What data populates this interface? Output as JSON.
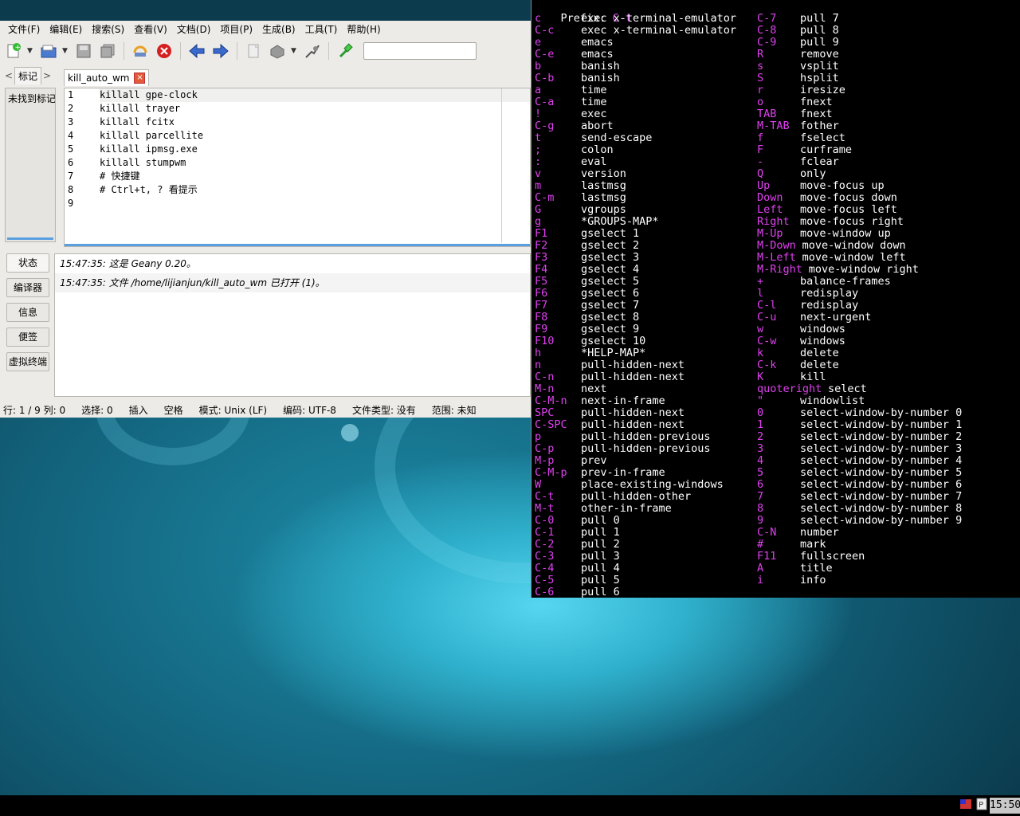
{
  "geany": {
    "menu": [
      "文件(F)",
      "编辑(E)",
      "搜索(S)",
      "查看(V)",
      "文档(D)",
      "项目(P)",
      "生成(B)",
      "工具(T)",
      "帮助(H)"
    ],
    "sidebar": {
      "tab_label": "标记",
      "empty_text": "未找到标记"
    },
    "editor_tab": {
      "label": "kill_auto_wm",
      "close": "×"
    },
    "lines": [
      "1",
      "2",
      "3",
      "4",
      "5",
      "6",
      "7",
      "8",
      "9"
    ],
    "code": [
      "killall gpe-clock",
      "killall trayer",
      "killall fcitx",
      "killall parcellite",
      "killall ipmsg.exe",
      "killall stumpwm",
      "# 快捷键",
      "# Ctrl+t, ? 看提示",
      ""
    ],
    "message_tabs": [
      "状态",
      "编译器",
      "信息",
      "便签",
      "虚拟终端"
    ],
    "messages": [
      "15:47:35: 这是 Geany 0.20。",
      "15:47:35: 文件 /home/lijianjun/kill_auto_wm 已打开 (1)。"
    ],
    "status": {
      "position": "行: 1 / 9  列: 0",
      "selection": "选择: 0",
      "insert": "插入",
      "indent": "空格",
      "mode": "模式: Unix (LF)",
      "encoding": "编码: UTF-8",
      "filetype": "文件类型: 没有",
      "scope": "范围: 未知"
    }
  },
  "terminal": {
    "prefix_label": "Prefix: ",
    "prefix_key": "C-t",
    "left": [
      [
        "c",
        "exec x-terminal-emulator"
      ],
      [
        "C-c",
        "exec x-terminal-emulator"
      ],
      [
        "e",
        "emacs"
      ],
      [
        "C-e",
        "emacs"
      ],
      [
        "b",
        "banish"
      ],
      [
        "C-b",
        "banish"
      ],
      [
        "a",
        "time"
      ],
      [
        "C-a",
        "time"
      ],
      [
        "!",
        "exec"
      ],
      [
        "C-g",
        "abort"
      ],
      [
        "t",
        "send-escape"
      ],
      [
        ";",
        "colon"
      ],
      [
        ":",
        "eval"
      ],
      [
        "v",
        "version"
      ],
      [
        "m",
        "lastmsg"
      ],
      [
        "C-m",
        "lastmsg"
      ],
      [
        "G",
        "vgroups"
      ],
      [
        "g",
        "*GROUPS-MAP*"
      ],
      [
        "F1",
        "gselect 1"
      ],
      [
        "F2",
        "gselect 2"
      ],
      [
        "F3",
        "gselect 3"
      ],
      [
        "F4",
        "gselect 4"
      ],
      [
        "F5",
        "gselect 5"
      ],
      [
        "F6",
        "gselect 6"
      ],
      [
        "F7",
        "gselect 7"
      ],
      [
        "F8",
        "gselect 8"
      ],
      [
        "F9",
        "gselect 9"
      ],
      [
        "F10",
        "gselect 10"
      ],
      [
        "h",
        "*HELP-MAP*"
      ],
      [
        "n",
        "pull-hidden-next"
      ],
      [
        "C-n",
        "pull-hidden-next"
      ],
      [
        "M-n",
        "next"
      ],
      [
        "C-M-n",
        "next-in-frame"
      ],
      [
        "SPC",
        "pull-hidden-next"
      ],
      [
        "C-SPC",
        "pull-hidden-next"
      ],
      [
        "p",
        "pull-hidden-previous"
      ],
      [
        "C-p",
        "pull-hidden-previous"
      ],
      [
        "M-p",
        "prev"
      ],
      [
        "C-M-p",
        "prev-in-frame"
      ],
      [
        "W",
        "place-existing-windows"
      ],
      [
        "C-t",
        "pull-hidden-other"
      ],
      [
        "M-t",
        "other-in-frame"
      ],
      [
        "C-0",
        "pull 0"
      ],
      [
        "C-1",
        "pull 1"
      ],
      [
        "C-2",
        "pull 2"
      ],
      [
        "C-3",
        "pull 3"
      ],
      [
        "C-4",
        "pull 4"
      ],
      [
        "C-5",
        "pull 5"
      ],
      [
        "C-6",
        "pull 6"
      ]
    ],
    "right": [
      [
        "C-7",
        "pull 7"
      ],
      [
        "C-8",
        "pull 8"
      ],
      [
        "C-9",
        "pull 9"
      ],
      [
        "R",
        "remove"
      ],
      [
        "s",
        "vsplit"
      ],
      [
        "S",
        "hsplit"
      ],
      [
        "r",
        "iresize"
      ],
      [
        "o",
        "fnext"
      ],
      [
        "TAB",
        "fnext"
      ],
      [
        "M-TAB",
        "fother"
      ],
      [
        "f",
        "fselect"
      ],
      [
        "F",
        "curframe"
      ],
      [
        "-",
        "fclear"
      ],
      [
        "Q",
        "only"
      ],
      [
        "Up",
        "move-focus up"
      ],
      [
        "Down",
        "move-focus down"
      ],
      [
        "Left",
        "move-focus left"
      ],
      [
        "Right",
        "move-focus right"
      ],
      [
        "M-Up",
        "move-window up"
      ],
      [
        "M-Down",
        "move-window down"
      ],
      [
        "M-Left",
        "move-window left"
      ],
      [
        "M-Right",
        "move-window right"
      ],
      [
        "+",
        "balance-frames"
      ],
      [
        "l",
        "redisplay"
      ],
      [
        "C-l",
        "redisplay"
      ],
      [
        "C-u",
        "next-urgent"
      ],
      [
        "w",
        "windows"
      ],
      [
        "C-w",
        "windows"
      ],
      [
        "k",
        "delete"
      ],
      [
        "C-k",
        "delete"
      ],
      [
        "K",
        "kill"
      ],
      [
        "quoteright",
        "select"
      ],
      [
        "\"",
        "windowlist"
      ],
      [
        "0",
        "select-window-by-number 0"
      ],
      [
        "1",
        "select-window-by-number 1"
      ],
      [
        "2",
        "select-window-by-number 2"
      ],
      [
        "3",
        "select-window-by-number 3"
      ],
      [
        "4",
        "select-window-by-number 4"
      ],
      [
        "5",
        "select-window-by-number 5"
      ],
      [
        "6",
        "select-window-by-number 6"
      ],
      [
        "7",
        "select-window-by-number 7"
      ],
      [
        "8",
        "select-window-by-number 8"
      ],
      [
        "9",
        "select-window-by-number 9"
      ],
      [
        "C-N",
        "number"
      ],
      [
        "#",
        "mark"
      ],
      [
        "F11",
        "fullscreen"
      ],
      [
        "A",
        "title"
      ],
      [
        "i",
        "info"
      ]
    ]
  },
  "taskbar": {
    "clock": "15:50"
  },
  "colors": {
    "key": "#e040f0",
    "command": "#ffffff",
    "terminal_bg": "#000000"
  }
}
